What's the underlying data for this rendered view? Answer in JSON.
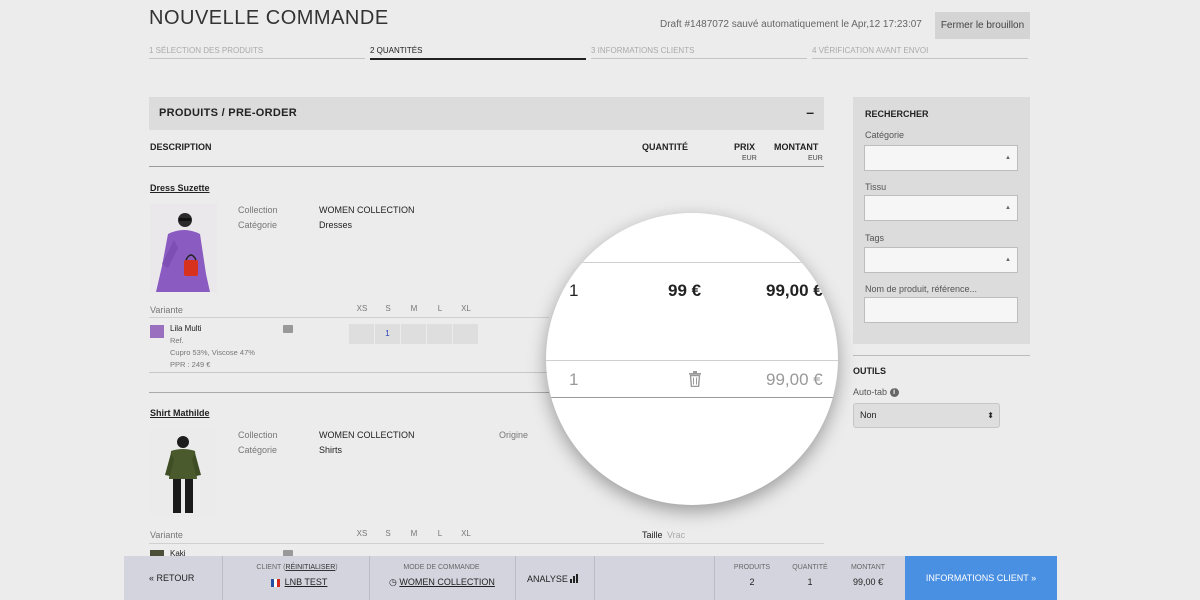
{
  "header": {
    "title": "NOUVELLE COMMANDE",
    "draft_text": "Draft #1487072 sauvé automatiquement le Apr,12 17:23:07",
    "close_draft": "Fermer le brouillon"
  },
  "steps": [
    {
      "label": "1 Sélection des produits"
    },
    {
      "label": "2 Quantités"
    },
    {
      "label": "3 Informations clients"
    },
    {
      "label": "4 Vérification avant envoi"
    }
  ],
  "section": {
    "title": "PRODUITS / PRE-ORDER",
    "collapse": "–"
  },
  "table_head": {
    "description": "DESCRIPTION",
    "quantite": "QUANTITÉ",
    "prix": "PRIX",
    "prix_unit": "EUR",
    "montant": "MONTANT",
    "montant_unit": "EUR"
  },
  "products": [
    {
      "name": "Dress Suzette",
      "collection_label": "Collection",
      "collection_value": "WOMEN COLLECTION",
      "category_label": "Catégorie",
      "category_value": "Dresses",
      "variant_label": "Variante",
      "sizes": [
        "XS",
        "S",
        "M",
        "L",
        "XL"
      ],
      "variant_name": "Lila Multi",
      "variant_ref": "Ref.",
      "variant_composition": "Cupro 53%, Viscose 47%",
      "variant_ppr": "PPR : 249 €",
      "quantities": [
        "",
        "1",
        "",
        "",
        ""
      ],
      "swatch_color": "#9b6fc0"
    },
    {
      "name": "Shirt Mathilde",
      "collection_label": "Collection",
      "collection_value": "WOMEN COLLECTION",
      "category_label": "Catégorie",
      "category_value": "Shirts",
      "origin_label": "Origine",
      "variant_label": "Variante",
      "sizes": [
        "XS",
        "S",
        "M",
        "L",
        "XL"
      ],
      "taille_label": "Taille",
      "vrac_label": "Vrac",
      "variant_name": "Kaki",
      "swatch_color": "#4b4f38"
    }
  ],
  "magnifier": {
    "row1_qty": "1",
    "row1_price": "99 €",
    "row1_amount": "99,00 €",
    "row2_qty": "1",
    "row2_amount": "99,00 €"
  },
  "sidebar": {
    "search_title": "RECHERCHER",
    "categorie_label": "Catégorie",
    "tissu_label": "Tissu",
    "tags_label": "Tags",
    "name_label": "Nom de produit, référence...",
    "tools_title": "OUTILS",
    "autotab_label": "Auto-tab",
    "autotab_value": "Non"
  },
  "bottombar": {
    "back": "« RETOUR",
    "client_label": "CLIENT",
    "client_reset": "RÉINITIALISER",
    "client_value": "LNB TEST",
    "mode_label": "MODE DE COMMANDE",
    "mode_value": "WOMEN COLLECTION",
    "analyse": "ANALYSE",
    "produits_label": "PRODUITS",
    "produits_value": "2",
    "quantite_label": "QUANTITÉ",
    "quantite_value": "1",
    "montant_label": "MONTANT",
    "montant_value": "99,00 €",
    "cta": "INFORMATIONS CLIENT »"
  },
  "colors": {
    "accent": "#4a90e2",
    "qty_text": "#2b3fbd"
  }
}
